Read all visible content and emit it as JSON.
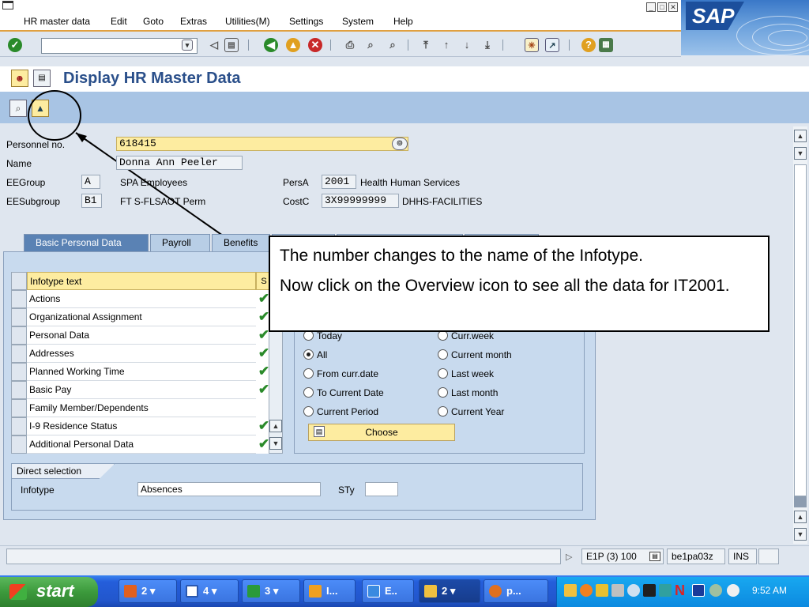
{
  "menu": {
    "items": [
      "HR master data",
      "Edit",
      "Goto",
      "Extras",
      "Utilities(M)",
      "Settings",
      "System",
      "Help"
    ]
  },
  "logo_text": "SAP",
  "title": "Display HR Master Data",
  "header": {
    "personnel_no_label": "Personnel no.",
    "personnel_no": "618415",
    "name_label": "Name",
    "name": "Donna Ann Peeler",
    "eegroup_label": "EEGroup",
    "eegroup_code": "A",
    "eegroup_text": "SPA Employees",
    "eesubgroup_label": "EESubgroup",
    "eesubgroup_code": "B1",
    "eesubgroup_text": "FT S-FLSAOT Perm",
    "persa_label": "PersA",
    "persa_code": "2001",
    "persa_text": "Health Human Services",
    "costc_label": "CostC",
    "costc_code": "3X99999999",
    "costc_text": "DHHS-FACILITIES"
  },
  "tabs": [
    "Basic Personal Data",
    "Payroll",
    "Benefits"
  ],
  "infotypes": {
    "header_text": "Infotype text",
    "header_s": "S",
    "rows": [
      {
        "text": "Actions",
        "check": "✔"
      },
      {
        "text": "Organizational Assignment",
        "check": "✔"
      },
      {
        "text": "Personal Data",
        "check": "✔"
      },
      {
        "text": "Addresses",
        "check": "✔"
      },
      {
        "text": "Planned Working Time",
        "check": "✔"
      },
      {
        "text": "Basic Pay",
        "check": "✔"
      },
      {
        "text": "Family Member/Dependents",
        "check": ""
      },
      {
        "text": "I-9 Residence Status",
        "check": "✔"
      },
      {
        "text": "Additional Personal Data",
        "check": "✔"
      }
    ]
  },
  "period": {
    "left": [
      "Today",
      "All",
      "From curr.date",
      "To Current Date",
      "Current Period"
    ],
    "right": [
      "Curr.week",
      "Current month",
      "Last week",
      "Last month",
      "Current Year"
    ],
    "selected": "All",
    "choose_label": "Choose"
  },
  "direct_selection": {
    "title": "Direct selection",
    "infotype_label": "Infotype",
    "infotype_value": "Absences",
    "sty_label": "STy",
    "sty_value": ""
  },
  "callout": {
    "line1": "The number changes to the name of the Infotype.",
    "line2": "Now click on the Overview icon to see all the data for IT2001."
  },
  "statusbar": {
    "system": "E1P (3) 100",
    "server": "be1pa03z",
    "mode": "INS"
  },
  "taskbar": {
    "start_label": "start",
    "tasks": [
      "2",
      "4",
      "3",
      "I...",
      "E..",
      "2",
      "p..."
    ],
    "clock": "9:52 AM"
  }
}
